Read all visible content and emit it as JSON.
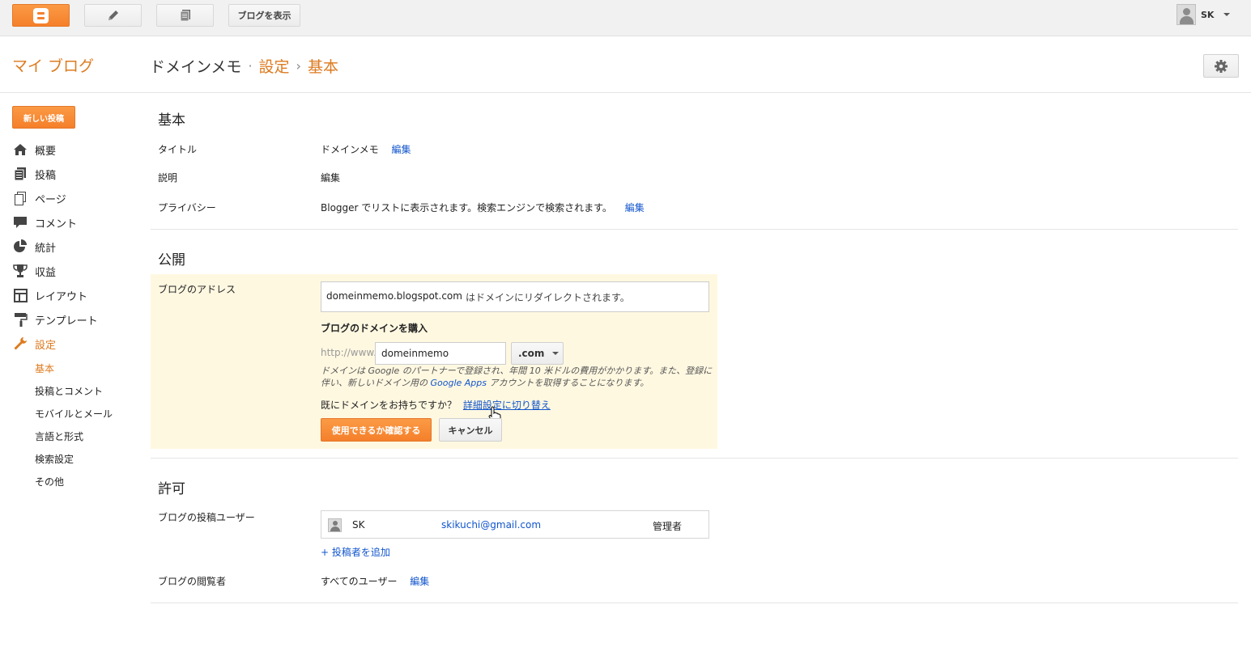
{
  "topbar": {
    "view_blog_label": "ブログを表示",
    "account_name": "SK"
  },
  "header": {
    "my_blog": "マイ ブログ",
    "blog_name": "ドメインメモ",
    "dot": "·",
    "settings": "設定",
    "chevron": "›",
    "current": "基本"
  },
  "sidebar": {
    "new_post": "新しい投稿",
    "items": [
      {
        "label": "概要",
        "icon": "home-icon"
      },
      {
        "label": "投稿",
        "icon": "posts-icon"
      },
      {
        "label": "ページ",
        "icon": "pages-icon"
      },
      {
        "label": "コメント",
        "icon": "comment-icon"
      },
      {
        "label": "統計",
        "icon": "pie-chart-icon"
      },
      {
        "label": "収益",
        "icon": "trophy-icon"
      },
      {
        "label": "レイアウト",
        "icon": "layout-icon"
      },
      {
        "label": "テンプレート",
        "icon": "paint-roller-icon"
      },
      {
        "label": "設定",
        "icon": "wrench-icon"
      }
    ],
    "sub_items": [
      "基本",
      "投稿とコメント",
      "モバイルとメール",
      "言語と形式",
      "検索設定",
      "その他"
    ]
  },
  "basic": {
    "title": "基本",
    "title_label": "タイトル",
    "title_value": "ドメインメモ",
    "description_label": "説明",
    "privacy_label": "プライバシー",
    "privacy_value": "Blogger でリストに表示されます。検索エンジンで検索されます。",
    "edit": "編集"
  },
  "publish": {
    "title": "公開",
    "address_label": "ブログのアドレス",
    "address_value": "domeinmemo.blogspot.com",
    "address_suffix": "はドメインにリダイレクトされます。",
    "buy_domain_title": "ブログのドメインを購入",
    "prefix": "http://www.",
    "domain_input": "domeinmemo",
    "tld": ".com",
    "note_part1": "ドメインは Google のパートナーで登録され、年間 10 米ドルの費用がかかります。また、登録に伴い、新しいドメイン用の ",
    "note_link": "Google Apps",
    "note_part2": " アカウントを取得することになります。",
    "have_domain": "既にドメインをお持ちですか？",
    "advanced_link": "詳細設定に切り替え",
    "check_button": "使用できるか確認する",
    "cancel_button": "キャンセル"
  },
  "permissions": {
    "title": "許可",
    "authors_label": "ブログの投稿ユーザー",
    "user_name": "SK",
    "user_email": "skikuchi@gmail.com",
    "user_role": "管理者",
    "add_author": "+ 投稿者を追加",
    "readers_label": "ブログの閲覧者",
    "readers_value": "すべてのユーザー",
    "edit": "編集"
  },
  "colors": {
    "accent": "#dd7a1f",
    "button_orange": "#f5802b",
    "link": "#15c",
    "highlight": "#fff8e1"
  }
}
